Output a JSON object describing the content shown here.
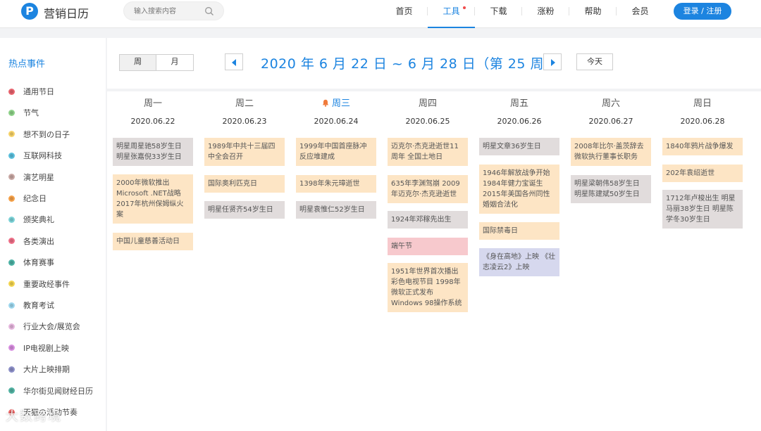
{
  "header": {
    "logo_letter": "P",
    "brand": "营销日历",
    "search_placeholder": "输入搜索内容",
    "nav": [
      {
        "label": "首页"
      },
      {
        "label": "工具"
      },
      {
        "label": "下载"
      },
      {
        "label": "涨粉"
      },
      {
        "label": "帮助"
      },
      {
        "label": "会员"
      }
    ],
    "login_label": "登录 / 注册"
  },
  "sidebar": {
    "title": "热点事件",
    "items": [
      {
        "label": "通用节日",
        "color": "#e8646e"
      },
      {
        "label": "节气",
        "color": "#8fd28a"
      },
      {
        "label": "想不到の日子",
        "color": "#f7d36a"
      },
      {
        "label": "互联网科技",
        "color": "#5cc0dd"
      },
      {
        "label": "演艺明星",
        "color": "#c9a9a5"
      },
      {
        "label": "纪念日",
        "color": "#f6a24a"
      },
      {
        "label": "颁奖典礼",
        "color": "#7dd3d8"
      },
      {
        "label": "各类演出",
        "color": "#ef7088"
      },
      {
        "label": "体育赛事",
        "color": "#4eb3a6"
      },
      {
        "label": "重要政经事件",
        "color": "#f4d652"
      },
      {
        "label": "教育考试",
        "color": "#9fd8ef"
      },
      {
        "label": "行业大会/展览会",
        "color": "#e6b8de"
      },
      {
        "label": "IP电视剧上映",
        "color": "#d88fe0"
      },
      {
        "label": "大片上映排期",
        "color": "#8d90c8"
      },
      {
        "label": "华尔街见闻财经日历",
        "color": "#53b3a3"
      },
      {
        "label": "天猫の活动节奏",
        "color": "#f06a6a"
      }
    ]
  },
  "toolbar": {
    "view_week": "周",
    "view_month": "月",
    "range": "2020 年 6 月 22 日 ~ 6 月 28 日（第 25 周）",
    "today": "今天"
  },
  "days": [
    {
      "name": "周一",
      "date": "2020.06.22",
      "today": false,
      "events": [
        {
          "text": "明星周星驰58岁生日 明星张嘉倪33岁生日",
          "color": "gray"
        },
        {
          "text": "2000年微软推出Microsoft .NET战略 2017年杭州保姆纵火案",
          "color": "orange"
        },
        {
          "text": "中国儿童慈善活动日",
          "color": "orange"
        }
      ]
    },
    {
      "name": "周二",
      "date": "2020.06.23",
      "today": false,
      "events": [
        {
          "text": "1989年中共十三届四中全会召开",
          "color": "orange"
        },
        {
          "text": "国际奥利匹克日",
          "color": "orange"
        },
        {
          "text": "明星任贤齐54岁生日",
          "color": "gray"
        }
      ]
    },
    {
      "name": "周三",
      "date": "2020.06.24",
      "today": true,
      "events": [
        {
          "text": "1999年中国首座脉冲反应堆建成",
          "color": "orange"
        },
        {
          "text": "1398年朱元璋逝世",
          "color": "orange"
        },
        {
          "text": "明星袁惟仁52岁生日",
          "color": "gray"
        }
      ]
    },
    {
      "name": "周四",
      "date": "2020.06.25",
      "today": false,
      "events": [
        {
          "text": "迈克尔·杰克逊逝世11周年 全国土地日",
          "color": "orange"
        },
        {
          "text": "635年李渊驾崩 2009年迈克尔·杰克逊逝世",
          "color": "orange"
        },
        {
          "text": "1924年邓稼先出生",
          "color": "gray"
        },
        {
          "text": "端午节",
          "color": "pink"
        },
        {
          "text": "1951年世界首次播出彩色电视节目 1998年微软正式发布Windows 98操作系统",
          "color": "orange"
        }
      ]
    },
    {
      "name": "周五",
      "date": "2020.06.26",
      "today": false,
      "events": [
        {
          "text": "明星文章36岁生日",
          "color": "gray"
        },
        {
          "text": "1946年解放战争开始 1984年健力宝诞生 2015年美国各州同性婚姻合法化",
          "color": "orange"
        },
        {
          "text": "国际禁毒日",
          "color": "orange"
        },
        {
          "text": "《身在高地》上映 《壮志凌云2》上映",
          "color": "lav"
        }
      ]
    },
    {
      "name": "周六",
      "date": "2020.06.27",
      "today": false,
      "events": [
        {
          "text": "2008年比尔·盖茨辞去微软执行董事长职务",
          "color": "orange"
        },
        {
          "text": "明星梁朝伟58岁生日 明星陈建斌50岁生日",
          "color": "gray"
        }
      ]
    },
    {
      "name": "周日",
      "date": "2020.06.28",
      "today": false,
      "events": [
        {
          "text": "1840年鸦片战争爆发",
          "color": "orange"
        },
        {
          "text": "202年袁绍逝世",
          "color": "orange"
        },
        {
          "text": "1712年卢梭出生 明星马丽38岁生日 明星陈学冬30岁生日",
          "color": "gray"
        }
      ]
    }
  ],
  "watermark": "大数跨境"
}
